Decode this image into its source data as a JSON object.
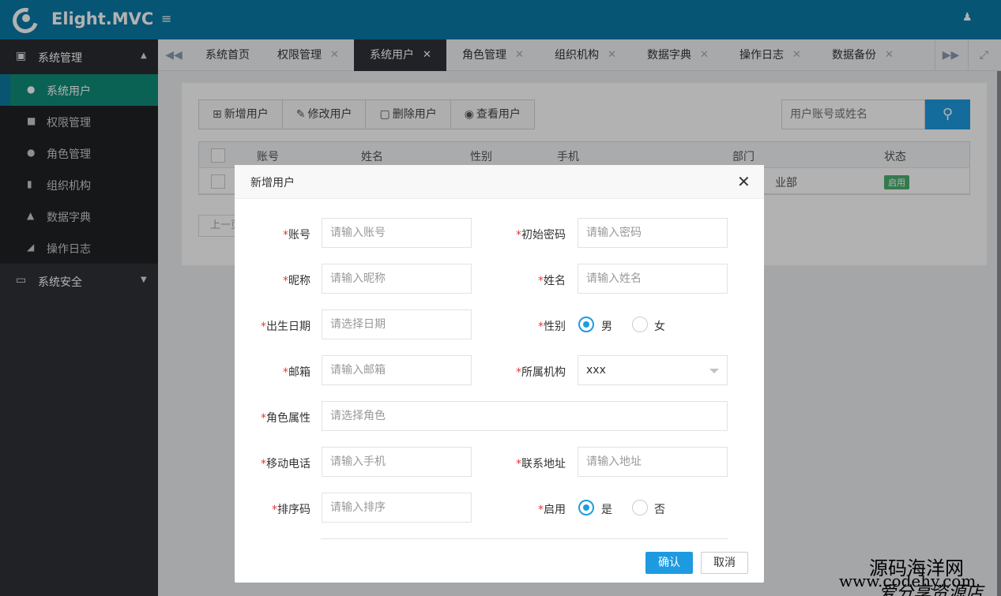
{
  "app": {
    "title": "Elight.MVC"
  },
  "sidebar": {
    "groups": [
      {
        "label": "系统管理",
        "icon": "cubes-icon"
      },
      {
        "label": "系统安全",
        "icon": "desktop-icon"
      }
    ],
    "items": [
      {
        "label": "系统用户",
        "icon": "user-circle-icon",
        "active": true
      },
      {
        "label": "权限管理",
        "icon": "briefcase-icon"
      },
      {
        "label": "角色管理",
        "icon": "users-icon"
      },
      {
        "label": "组织机构",
        "icon": "building-icon"
      },
      {
        "label": "数据字典",
        "icon": "sitemap-icon"
      },
      {
        "label": "操作日志",
        "icon": "folder-open-icon"
      }
    ]
  },
  "tabs": [
    {
      "label": "系统首页",
      "closable": false
    },
    {
      "label": "权限管理",
      "closable": true
    },
    {
      "label": "系统用户",
      "closable": true,
      "active": true
    },
    {
      "label": "角色管理",
      "closable": true
    },
    {
      "label": "组织机构",
      "closable": true
    },
    {
      "label": "数据字典",
      "closable": true
    },
    {
      "label": "操作日志",
      "closable": true
    },
    {
      "label": "数据备份",
      "closable": true
    }
  ],
  "toolbar": {
    "add": "新增用户",
    "edit": "修改用户",
    "delete": "删除用户",
    "view": "查看用户"
  },
  "search": {
    "placeholder": "用户账号或姓名"
  },
  "table": {
    "columns": [
      "账号",
      "姓名",
      "性别",
      "手机",
      "部门",
      "状态"
    ],
    "rows": [
      {
        "dept": "业部",
        "status": "启用"
      }
    ]
  },
  "pager": {
    "prev": "上一页"
  },
  "modal": {
    "title": "新增用户",
    "fields": {
      "account": {
        "label": "账号",
        "placeholder": "请输入账号"
      },
      "password": {
        "label": "初始密码",
        "placeholder": "请输入密码"
      },
      "nickname": {
        "label": "昵称",
        "placeholder": "请输入昵称"
      },
      "realname": {
        "label": "姓名",
        "placeholder": "请输入姓名"
      },
      "birthday": {
        "label": "出生日期",
        "placeholder": "请选择日期"
      },
      "gender": {
        "label": "性别",
        "options": [
          "男",
          "女"
        ],
        "selected": "男"
      },
      "email": {
        "label": "邮箱",
        "placeholder": "请输入邮箱"
      },
      "org": {
        "label": "所属机构",
        "value": "xxx"
      },
      "role": {
        "label": "角色属性",
        "placeholder": "请选择角色"
      },
      "mobile": {
        "label": "移动电话",
        "placeholder": "请输入手机"
      },
      "address": {
        "label": "联系地址",
        "placeholder": "请输入地址"
      },
      "sort": {
        "label": "排序码",
        "placeholder": "请输入排序"
      },
      "enabled": {
        "label": "启用",
        "options": [
          "是",
          "否"
        ],
        "selected": "是"
      }
    },
    "confirm": "确认",
    "cancel": "取消"
  },
  "watermark": {
    "line1": "源码海洋网",
    "line2": "www.codehy.com",
    "line3": "爱分享资源店"
  },
  "colors": {
    "header": "#0b7aa6",
    "accent": "#1e9be0",
    "active_menu": "#0f8d7a",
    "sidebar": "#2e3136"
  }
}
